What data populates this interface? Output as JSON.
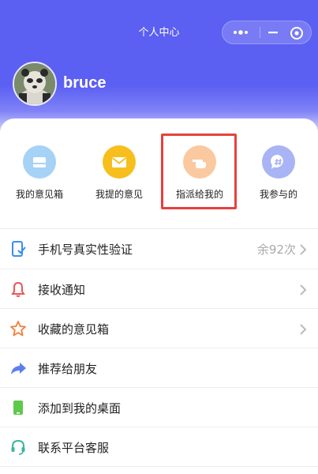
{
  "nav": {
    "title": "个人中心"
  },
  "user": {
    "name": "bruce"
  },
  "quick_actions": [
    {
      "label": "我的意见箱",
      "icon": "inbox-icon",
      "color": "#a6d2f5"
    },
    {
      "label": "我提的意见",
      "icon": "mail-icon",
      "color": "#f7bf1e"
    },
    {
      "label": "指派给我的",
      "icon": "pointing-hand-icon",
      "color": "#fbc9a0"
    },
    {
      "label": "我参与的",
      "icon": "chat-hashtag-icon",
      "color": "#a9b4f5"
    }
  ],
  "menu": [
    {
      "label": "手机号真实性验证",
      "extra": "余92次",
      "icon": "phone-check-icon",
      "color": "#3a8ef0",
      "arrow": true
    },
    {
      "label": "接收通知",
      "icon": "bell-icon",
      "color": "#ee5555",
      "arrow": true
    },
    {
      "label": "收藏的意见箱",
      "icon": "star-icon",
      "color": "#f07f3c",
      "arrow": true
    },
    {
      "label": "推荐给朋友",
      "icon": "share-arrow-icon",
      "color": "#5c7ff0",
      "arrow": false
    },
    {
      "label": "添加到我的桌面",
      "icon": "mobile-icon",
      "color": "#5ec94d",
      "arrow": false
    },
    {
      "label": "联系平台客服",
      "icon": "headset-icon",
      "color": "#36b89a",
      "arrow": false
    }
  ],
  "colors": {
    "header": "#5b5ff2",
    "highlight_box": "#e8413c"
  }
}
